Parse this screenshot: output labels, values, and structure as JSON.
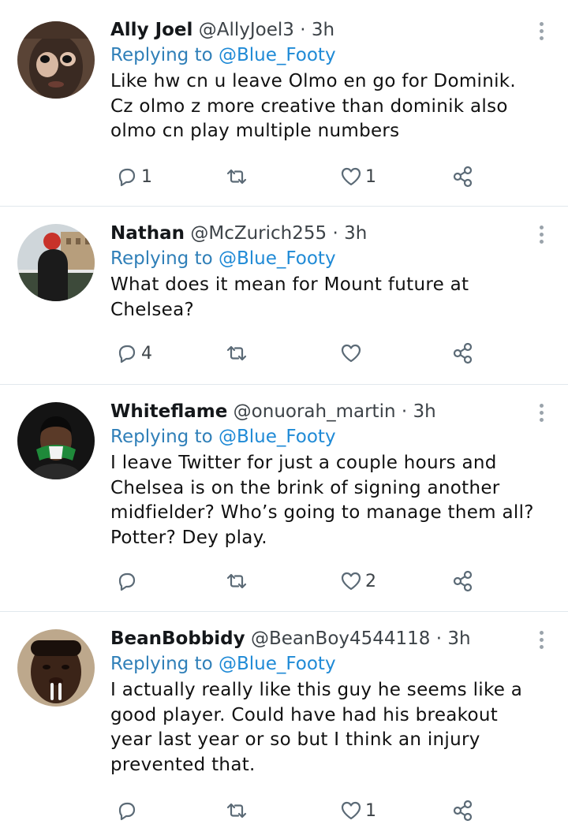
{
  "tweets": [
    {
      "name": "Ally Joel",
      "handle": "@AllyJoel3",
      "dot": "·",
      "time": "3h",
      "replying_label": "Replying to",
      "replying_to": "@Blue_Footy",
      "text": "Like hw cn u leave Olmo en go for Dominik. Cz olmo z more creative than dominik also olmo cn play multiple numbers",
      "replies": "1",
      "retweets": "",
      "likes": "1",
      "avatar_icon": "profile-photo"
    },
    {
      "name": "Nathan",
      "handle": "@McZurich255",
      "dot": "·",
      "time": "3h",
      "replying_label": "Replying to",
      "replying_to": "@Blue_Footy",
      "text": "What does it mean for Mount future at Chelsea?",
      "replies": "4",
      "retweets": "",
      "likes": "",
      "avatar_icon": "profile-photo"
    },
    {
      "name": "Whiteflame",
      "handle": "@onuorah_martin",
      "dot": "·",
      "time": "3h",
      "replying_label": "Replying to",
      "replying_to": "@Blue_Footy",
      "text": "I leave Twitter for just a couple hours and Chelsea is on the brink of signing another midfielder? Who’s going to manage them all? Potter? Dey play.",
      "replies": "",
      "retweets": "",
      "likes": "2",
      "avatar_icon": "profile-photo"
    },
    {
      "name": "BeanBobbidy",
      "handle": "@BeanBoy4544118",
      "dot": "·",
      "time": "3h",
      "replying_label": "Replying to",
      "replying_to": "@Blue_Footy",
      "text": "I actually really like this guy he seems like a good player. Could have had his breakout year last year or so but I think an injury prevented that.",
      "replies": "",
      "retweets": "",
      "likes": "1",
      "avatar_icon": "profile-photo"
    }
  ],
  "icons": {
    "reply": "reply-icon",
    "retweet": "retweet-icon",
    "like": "heart-icon",
    "share": "share-icon",
    "more": "more-vertical-icon"
  },
  "colors": {
    "mention": "#1f8ad6",
    "icon": "#5b6a76",
    "divider": "#e1e8ed"
  }
}
